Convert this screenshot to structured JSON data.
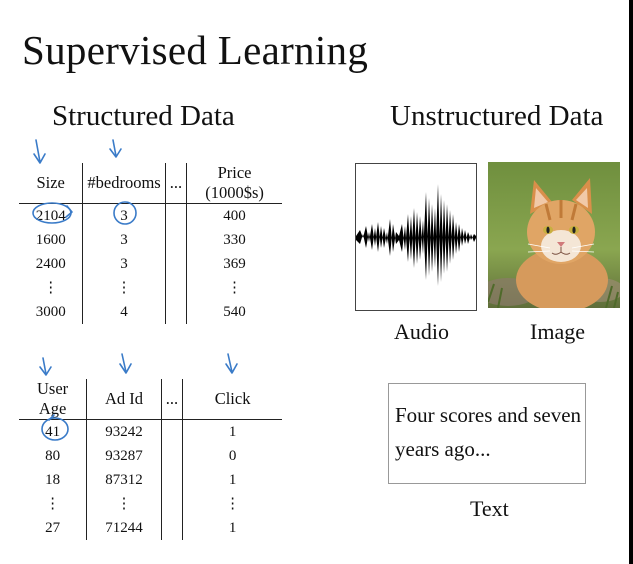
{
  "title": "Supervised Learning",
  "structured": {
    "heading": "Structured Data",
    "housing": {
      "columns": [
        "Size",
        "#bedrooms",
        "...",
        "Price (1000$s)"
      ],
      "rows": [
        [
          "2104",
          "3",
          "",
          "400"
        ],
        [
          "1600",
          "3",
          "",
          "330"
        ],
        [
          "2400",
          "3",
          "",
          "369"
        ],
        [
          "⋮",
          "⋮",
          "",
          "⋮"
        ],
        [
          "3000",
          "4",
          "",
          "540"
        ]
      ]
    },
    "ads": {
      "columns": [
        "User Age",
        "Ad Id",
        "...",
        "Click"
      ],
      "rows": [
        [
          "41",
          "93242",
          "",
          "1"
        ],
        [
          "80",
          "93287",
          "",
          "0"
        ],
        [
          "18",
          "87312",
          "",
          "1"
        ],
        [
          "⋮",
          "⋮",
          "",
          "⋮"
        ],
        [
          "27",
          "71244",
          "",
          "1"
        ]
      ]
    }
  },
  "unstructured": {
    "heading": "Unstructured Data",
    "audio_label": "Audio",
    "image_label": "Image",
    "text_label": "Text",
    "text_sample": "Four scores and seven years ago..."
  },
  "colors": {
    "annotation": "#3a7bc8"
  }
}
